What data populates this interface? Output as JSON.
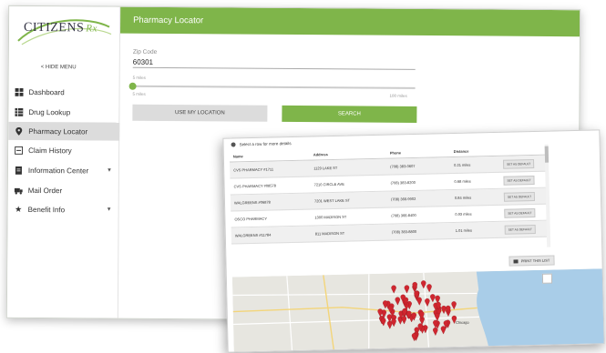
{
  "brand": {
    "name": "CITIZENS",
    "suffix": "Rx"
  },
  "sidebar": {
    "hide_menu": "< HIDE MENU",
    "items": [
      {
        "label": "Dashboard",
        "icon": "dashboard-icon"
      },
      {
        "label": "Drug Lookup",
        "icon": "table-icon"
      },
      {
        "label": "Pharmacy Locator",
        "icon": "map-pin-icon",
        "active": true
      },
      {
        "label": "Claim History",
        "icon": "history-icon"
      },
      {
        "label": "Information Center",
        "icon": "document-icon",
        "expandable": true
      },
      {
        "label": "Mail Order",
        "icon": "truck-icon"
      },
      {
        "label": "Benefit Info",
        "icon": "star-icon",
        "expandable": true
      }
    ]
  },
  "header": {
    "title": "Pharmacy Locator"
  },
  "search": {
    "zip_label": "Zip Code",
    "zip_value": "60301",
    "radius_top_label": "5 miles",
    "radius_min_label": "5 miles",
    "radius_max_label": "100 miles",
    "radius_fraction": 0.0,
    "use_location_label": "USE MY LOCATION",
    "search_label": "SEARCH"
  },
  "results": {
    "select_message": "Select a row for more details",
    "columns": [
      "Name",
      "Address",
      "Phone",
      "Distance",
      ""
    ],
    "rows": [
      {
        "name": "CVS PHARMACY #1711",
        "address": "1129 LAKE ST",
        "phone": "(708) 383-0607",
        "distance": "0.21 miles",
        "action": "SET AS DEFAULT"
      },
      {
        "name": "CVS PHARMACY #08578",
        "address": "7210 CIRCLE AVE",
        "phone": "(708) 383-8200",
        "distance": "0.68 miles",
        "action": "SET AS DEFAULT"
      },
      {
        "name": "WALGREENS #06878",
        "address": "7201 WEST LAKE ST",
        "phone": "(708) 366-9902",
        "distance": "0.84 miles",
        "action": "SET AS DEFAULT"
      },
      {
        "name": "OSCO PHARMACY",
        "address": "1300 MADISON ST",
        "phone": "(708) 366-8400",
        "distance": "0.93 miles",
        "action": "SET AS DEFAULT"
      },
      {
        "name": "WALGREENS #11784",
        "address": "811 MADISON ST",
        "phone": "(708) 383-8800",
        "distance": "1.01 miles",
        "action": "SET AS DEFAULT"
      }
    ],
    "print_label": "PRINT THIS LIST"
  },
  "map": {
    "city_label": "Chicago",
    "pin_color": "#d0262f",
    "water_color": "#a9cde8",
    "land_color": "#e7e6e0"
  },
  "colors": {
    "accent": "#7fb54a"
  }
}
